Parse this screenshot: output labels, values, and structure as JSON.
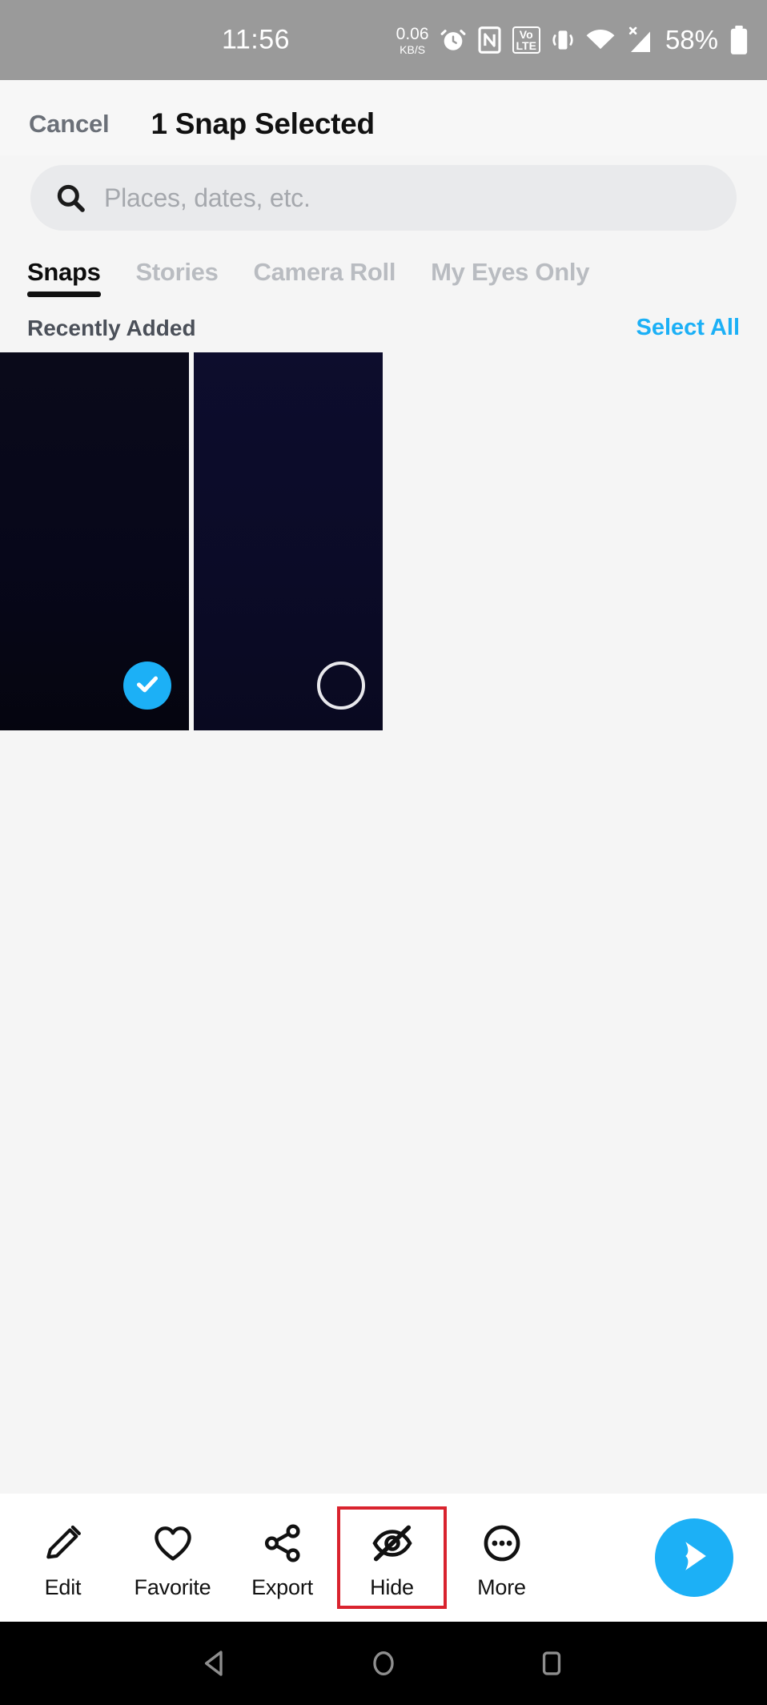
{
  "status_bar": {
    "time": "11:56",
    "data_rate_value": "0.06",
    "data_rate_unit": "KB/S",
    "alarm_icon": "alarm-clock-icon",
    "nfc_icon": "nfc-icon",
    "volte_line1": "Vo",
    "volte_line2": "LTE",
    "vibrate_icon": "vibrate-icon",
    "wifi_icon": "wifi-icon",
    "signal_icon": "cellular-signal-no-data-icon",
    "battery_percent": "58%",
    "battery_icon": "battery-icon",
    "background": "#9a9a9a"
  },
  "header": {
    "cancel_label": "Cancel",
    "title": "1 Snap Selected"
  },
  "search": {
    "placeholder": "Places, dates, etc.",
    "value": "",
    "icon": "search-icon"
  },
  "tabs": [
    {
      "label": "Snaps",
      "active": true
    },
    {
      "label": "Stories",
      "active": false
    },
    {
      "label": "Camera Roll",
      "active": false
    },
    {
      "label": "My Eyes Only",
      "active": false
    }
  ],
  "section": {
    "title": "Recently Added",
    "select_all_label": "Select All",
    "select_all_color": "#1cb0f6"
  },
  "grid": {
    "items": [
      {
        "name": "snap-thumbnail-1",
        "selected": true,
        "color_top": "#0a0a1a",
        "color_bottom": "#05050f",
        "badge": "check-icon"
      },
      {
        "name": "snap-thumbnail-2",
        "selected": false,
        "color_top": "#0d0d2b",
        "color_bottom": "#0a0a22",
        "badge": "empty-circle-icon"
      }
    ]
  },
  "toolbar": {
    "items": [
      {
        "label": "Edit",
        "icon": "pencil-icon",
        "highlighted": false
      },
      {
        "label": "Favorite",
        "icon": "heart-icon",
        "highlighted": false
      },
      {
        "label": "Export",
        "icon": "share-icon",
        "highlighted": false
      },
      {
        "label": "Hide",
        "icon": "eye-off-icon",
        "highlighted": true
      },
      {
        "label": "More",
        "icon": "more-dots-icon",
        "highlighted": false
      }
    ],
    "send_icon": "send-arrow-icon",
    "send_color": "#1cb0f6",
    "highlight_color": "#d9232e"
  },
  "nav_bar": {
    "back_icon": "back-triangle-icon",
    "home_icon": "home-circle-icon",
    "recents_icon": "recents-square-icon"
  }
}
